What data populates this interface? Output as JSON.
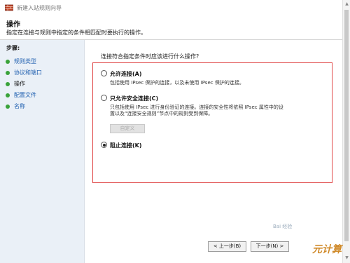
{
  "window": {
    "title": "新建入站规则向导"
  },
  "header": {
    "title": "操作",
    "description": "指定在连接与规则中指定的条件相匹配时要执行的操作。"
  },
  "sidebar": {
    "steps_label": "步骤:",
    "items": [
      {
        "label": "规则类型"
      },
      {
        "label": "协议和端口"
      },
      {
        "label": "操作"
      },
      {
        "label": "配置文件"
      },
      {
        "label": "名称"
      }
    ]
  },
  "main": {
    "question": "连接符合指定条件时应该进行什么操作?",
    "options": [
      {
        "label": "允许连接(A)",
        "desc": [
          "包括使用 IPsec 保护的连接，以及未使用 IPsec 保护的连接。"
        ],
        "checked": false
      },
      {
        "label": "只允许安全连接(C)",
        "desc": [
          "只包括使用 IPsec 进行身份验证的连接。连接的安全性将依照 IPsec 属性中的设",
          "置以及“连接安全规则”节点中的规则受到保障。"
        ],
        "checked": false
      },
      {
        "label": "阻止连接(K)",
        "desc": [],
        "checked": true
      }
    ],
    "custom_button": "自定义"
  },
  "footer": {
    "back_button": "< 上一步(B)",
    "next_button": "下一步(N) >"
  },
  "watermark": {
    "main": "元计算",
    "small": "Bai 经验"
  },
  "colors": {
    "highlight_border": "#e04848",
    "step_dot": "#3aa33a",
    "link": "#2060b0"
  }
}
